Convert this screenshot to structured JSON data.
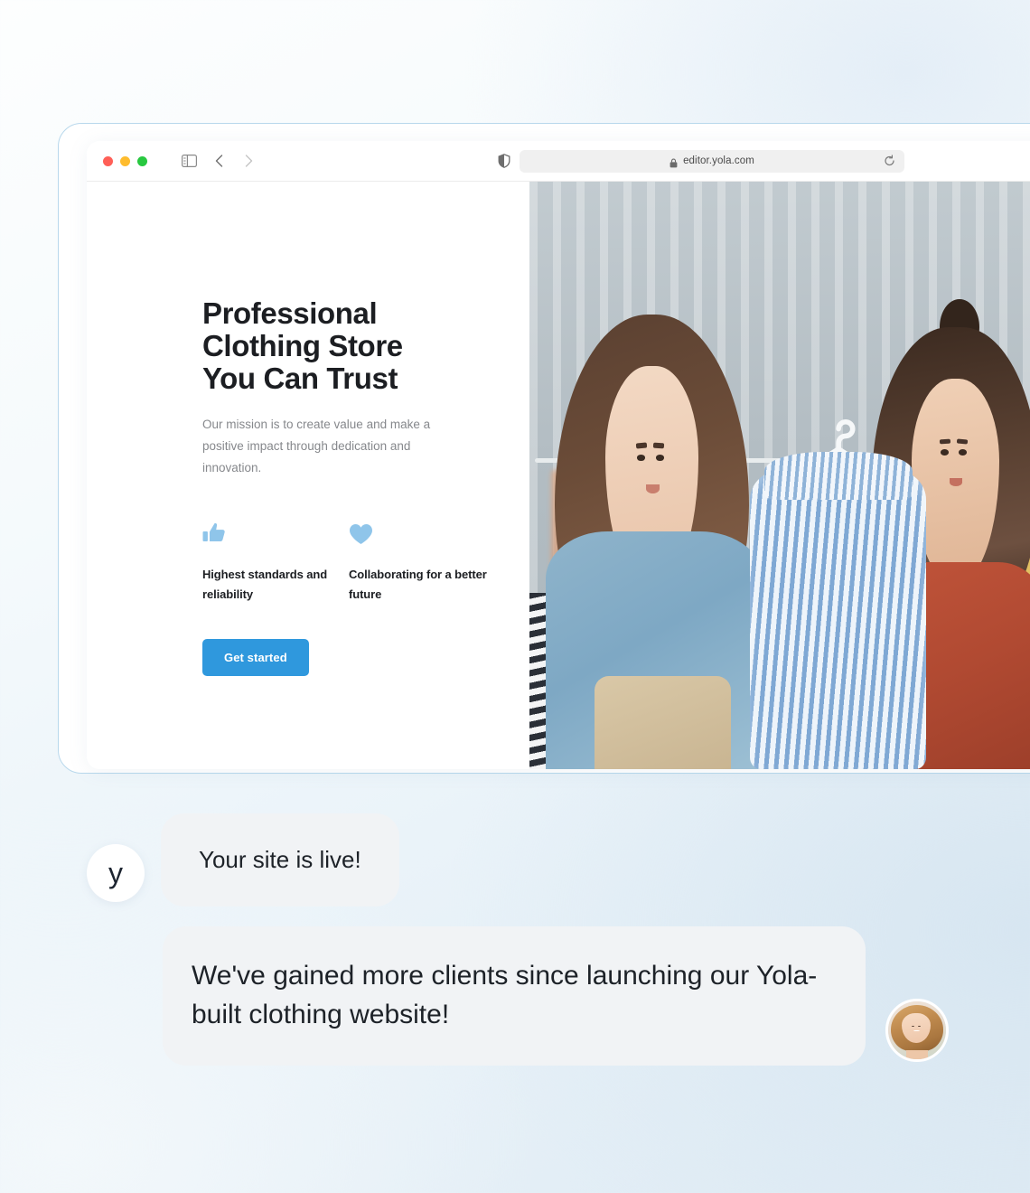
{
  "browser": {
    "traffic_lights": [
      "close",
      "minimize",
      "maximize"
    ],
    "sidebar_icon": "sidebar-toggle-icon",
    "back_icon": "chevron-left-icon",
    "forward_icon": "chevron-right-icon",
    "shield_icon": "shield-privacy-icon",
    "lock_icon": "lock-icon",
    "url": "editor.yola.com",
    "reload_icon": "reload-icon"
  },
  "site": {
    "hero": {
      "title_line1": "Professional",
      "title_line2": "Clothing Store",
      "title_line3": "You Can Trust",
      "subtitle": "Our mission is to create value and make a positive impact through dedication and innovation.",
      "cta_label": "Get started",
      "cta_color": "#2f98dd",
      "icon_color": "#8fc5ea",
      "features": [
        {
          "icon": "thumbs-up-icon",
          "label": "Highest standards and reliability"
        },
        {
          "icon": "heart-icon",
          "label": "Collaborating for a better future"
        }
      ],
      "image_alt": "Two women in a clothing store holding a blue striped dress on a hanger"
    }
  },
  "chat": {
    "messages": [
      {
        "avatar": "yola-logo-avatar",
        "avatar_letter": "y",
        "text": "Your site is live!"
      },
      {
        "avatar": "customer-photo-avatar",
        "text": "We've gained more clients since launching our Yola-built clothing website!"
      }
    ]
  },
  "theme": {
    "background_top": "#fdfefe",
    "background_bottom": "#dfebf4",
    "frame_border": "#b8d8ec",
    "bubble_bg": "#f1f3f5",
    "text_dark": "#1d2228"
  }
}
